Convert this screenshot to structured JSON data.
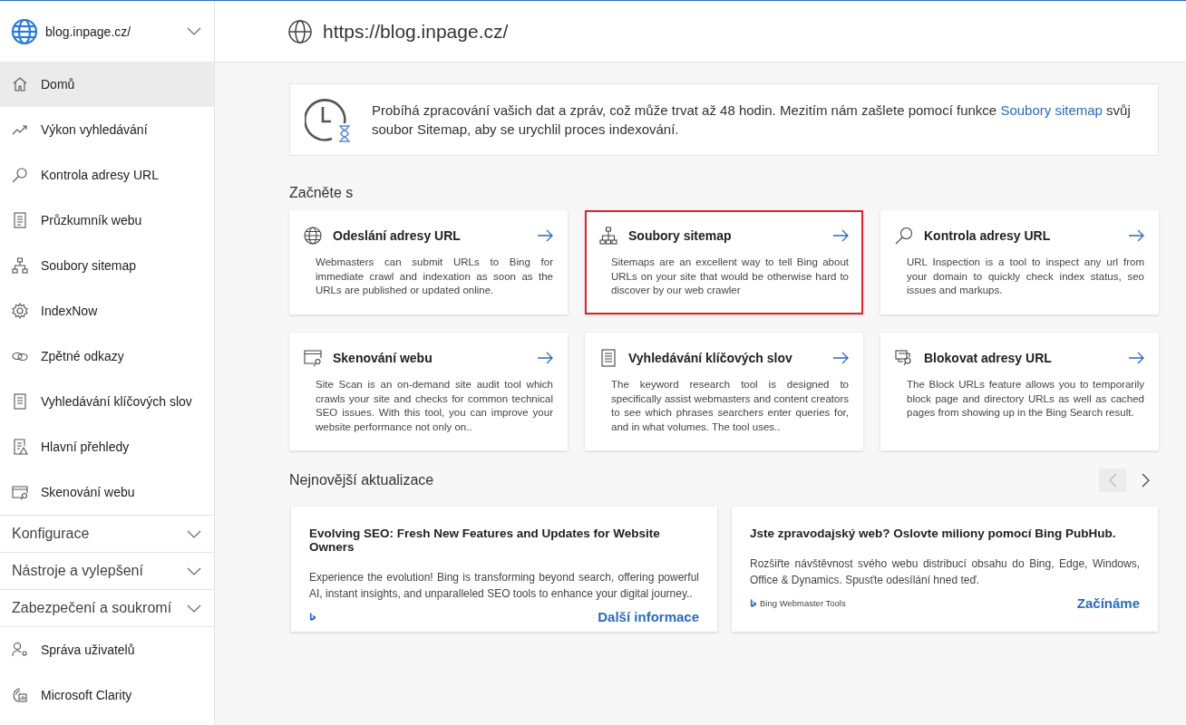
{
  "site_selector": {
    "label": "blog.inpage.cz/",
    "expanded": false
  },
  "nav_items": [
    {
      "label": "Domů",
      "selected": true
    },
    {
      "label": "Výkon vyhledávání",
      "selected": false
    },
    {
      "label": "Kontrola adresy URL",
      "selected": false
    },
    {
      "label": "Průzkumník webu",
      "selected": false
    },
    {
      "label": "Soubory sitemap",
      "selected": false
    },
    {
      "label": "IndexNow",
      "selected": false
    },
    {
      "label": "Zpětné odkazy",
      "selected": false
    },
    {
      "label": "Vyhledávání klíčových slov",
      "selected": false
    },
    {
      "label": "Hlavní přehledy",
      "selected": false
    },
    {
      "label": "Skenování webu",
      "selected": false
    }
  ],
  "nav_sections": [
    {
      "label": "Konfigurace",
      "expanded": false
    },
    {
      "label": "Nástroje a vylepšení",
      "expanded": false
    },
    {
      "label": "Zabezpečení a soukromí",
      "expanded": false
    }
  ],
  "nav_bottom_items": [
    {
      "label": "Správa uživatelů",
      "selected": false
    },
    {
      "label": "Microsoft Clarity",
      "selected": false
    }
  ],
  "header": {
    "url": "https://blog.inpage.cz/"
  },
  "notice": {
    "text": "Probíhá zpracování vašich dat a zpráv, což může trvat až 48 hodin. Mezitím nám zašlete pomocí funkce",
    "link": "Soubory sitemap",
    "text_after": "svůj soubor Sitemap, aby se urychlil proces indexování."
  },
  "get_started": {
    "heading": "Začněte s",
    "cards": [
      {
        "title": "Odeslání adresy URL",
        "description": "Webmasters can submit URLs to Bing for immediate crawl and indexation as soon as the URLs are published or updated online.",
        "highlighted": false
      },
      {
        "title": "Soubory sitemap",
        "description": "Sitemaps are an excellent way to tell Bing about URLs on your site that would be otherwise hard to discover by our web crawler",
        "highlighted": true
      },
      {
        "title": "Kontrola adresy URL",
        "description": "URL Inspection is a tool to inspect any url from your domain to quickly check index status, seo issues and markups.",
        "highlighted": false
      },
      {
        "title": "Skenování webu",
        "description": "Site Scan is an on-demand site audit tool which crawls your site and checks for common technical SEO issues. With this tool, you can improve your website performance not only on..",
        "highlighted": false
      },
      {
        "title": "Vyhledávání klíčových slov",
        "description": "The keyword research tool is designed to specifically assist webmasters and content creators to see which phrases searchers enter queries for, and in what volumes. The tool uses..",
        "highlighted": false
      },
      {
        "title": "Blokovat adresy URL",
        "description": "The Block URLs feature allows you to temporarily block page and directory URLs as well as cached pages from showing up in the Bing Search result.",
        "highlighted": false
      }
    ]
  },
  "updates": {
    "heading": "Nejnovější aktualizace",
    "prev_disabled": true,
    "next_disabled": false,
    "cards": [
      {
        "title": "Evolving SEO: Fresh New Features and Updates for Website Owners",
        "text": "Experience the evolution! Bing is transforming beyond search, offering powerful AI, instant insights, and unparalleled SEO tools to enhance your digital journey..",
        "link": "Další informace"
      },
      {
        "title": "Jste zpravodajský web? Oslovte miliony pomocí Bing PubHub.",
        "text": "Rozšiřte návštěvnost svého webu distribucí obsahu do Bing, Edge, Windows, Office & Dynamics. Spusťte odesílání hned teď.",
        "brand": "Bing Webmaster Tools",
        "link": "Začínáme"
      }
    ]
  }
}
